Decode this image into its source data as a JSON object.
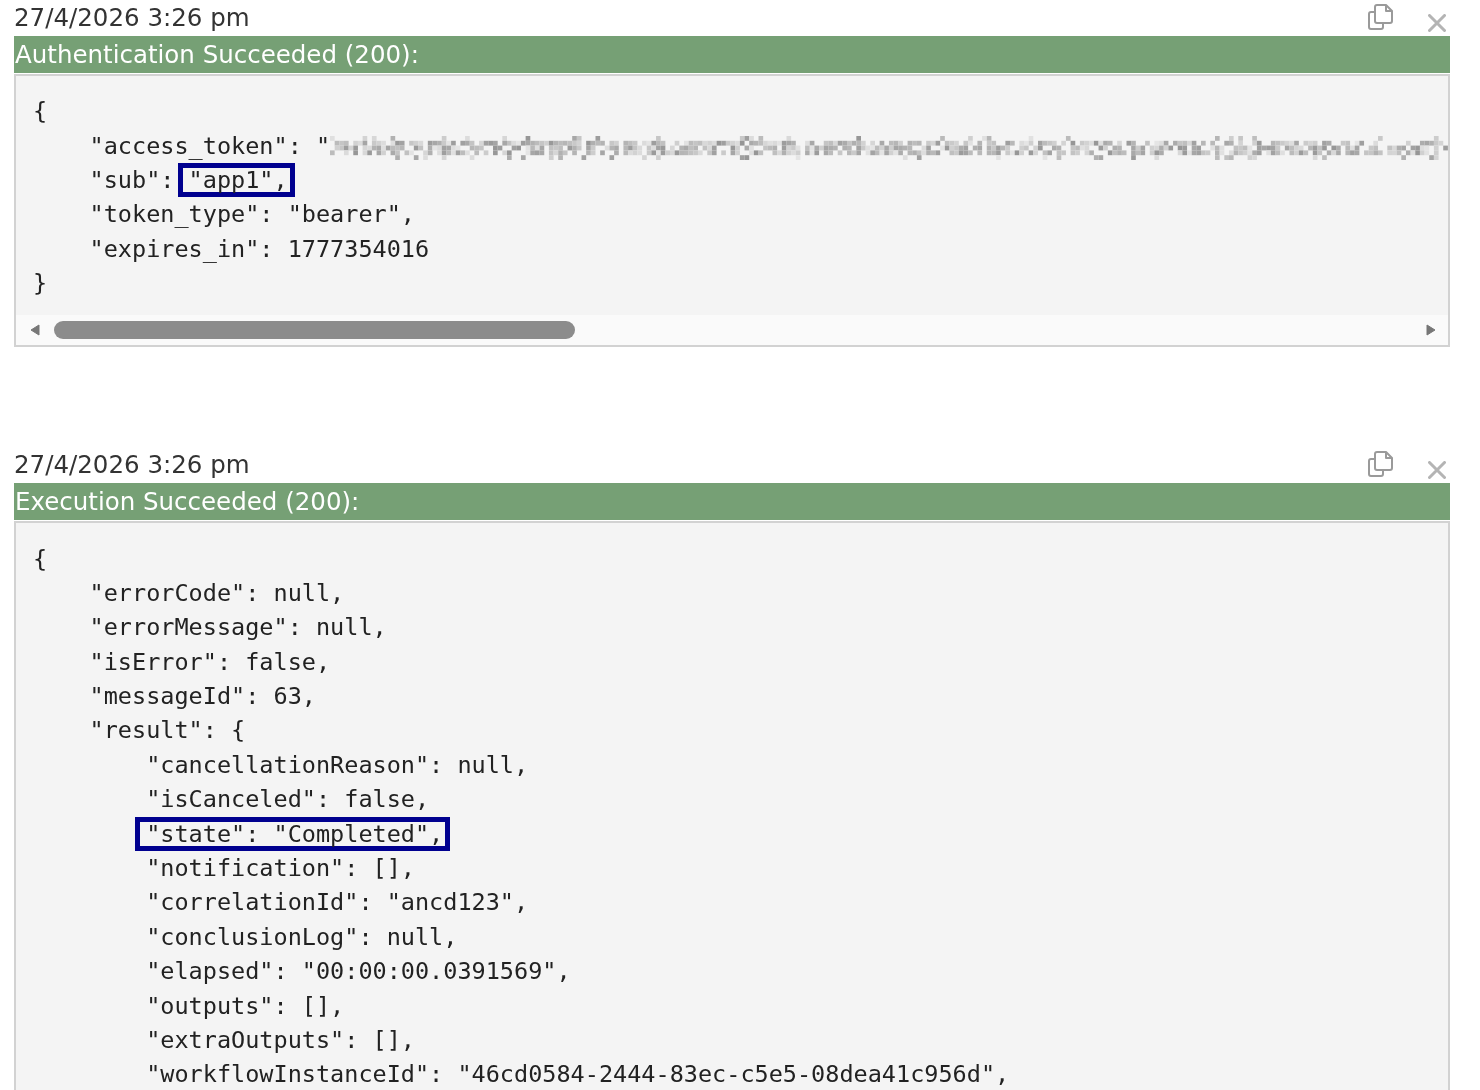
{
  "panels": [
    {
      "timestamp": "27/4/2026 3:26 pm",
      "status": {
        "kind": "success",
        "label": "Authentication Succeeded (200):"
      },
      "horizontal_scroll": true,
      "lines": [
        {
          "text": "{",
          "children": [
            {
              "text": "\"access_token\": \"",
              "redacted": true
            },
            {
              "text": "\"sub\":",
              "highlight": "\"app1\","
            },
            {
              "text": "\"token_type\": \"bearer\","
            },
            {
              "text": "\"expires_in\": 1777354016"
            }
          ]
        },
        {
          "text": "}"
        }
      ]
    },
    {
      "timestamp": "27/4/2026 3:26 pm",
      "status": {
        "kind": "success",
        "label": "Execution Succeeded (200):"
      },
      "lines": [
        {
          "text": "{",
          "children": [
            {
              "text": "\"errorCode\": null,"
            },
            {
              "text": "\"errorMessage\": null,"
            },
            {
              "text": "\"isError\": false,"
            },
            {
              "text": "\"messageId\": 63,"
            },
            {
              "text": "\"result\": {",
              "children": [
                {
                  "text": "\"cancellationReason\": null,"
                },
                {
                  "text": "\"isCanceled\": false,"
                },
                {
                  "highlight": "\"state\": \"Completed\","
                },
                {
                  "text": "\"notification\": [],"
                },
                {
                  "text": "\"correlationId\": \"ancd123\","
                },
                {
                  "text": "\"conclusionLog\": null,"
                },
                {
                  "text": "\"elapsed\": \"00:00:00.0391569\","
                },
                {
                  "text": "\"outputs\": [],"
                },
                {
                  "text": "\"extraOutputs\": [],"
                },
                {
                  "text": "\"workflowInstanceId\": \"46cd0584-2444-83ec-c5e5-08dea41c956d\","
                }
              ]
            }
          ]
        }
      ]
    }
  ]
}
